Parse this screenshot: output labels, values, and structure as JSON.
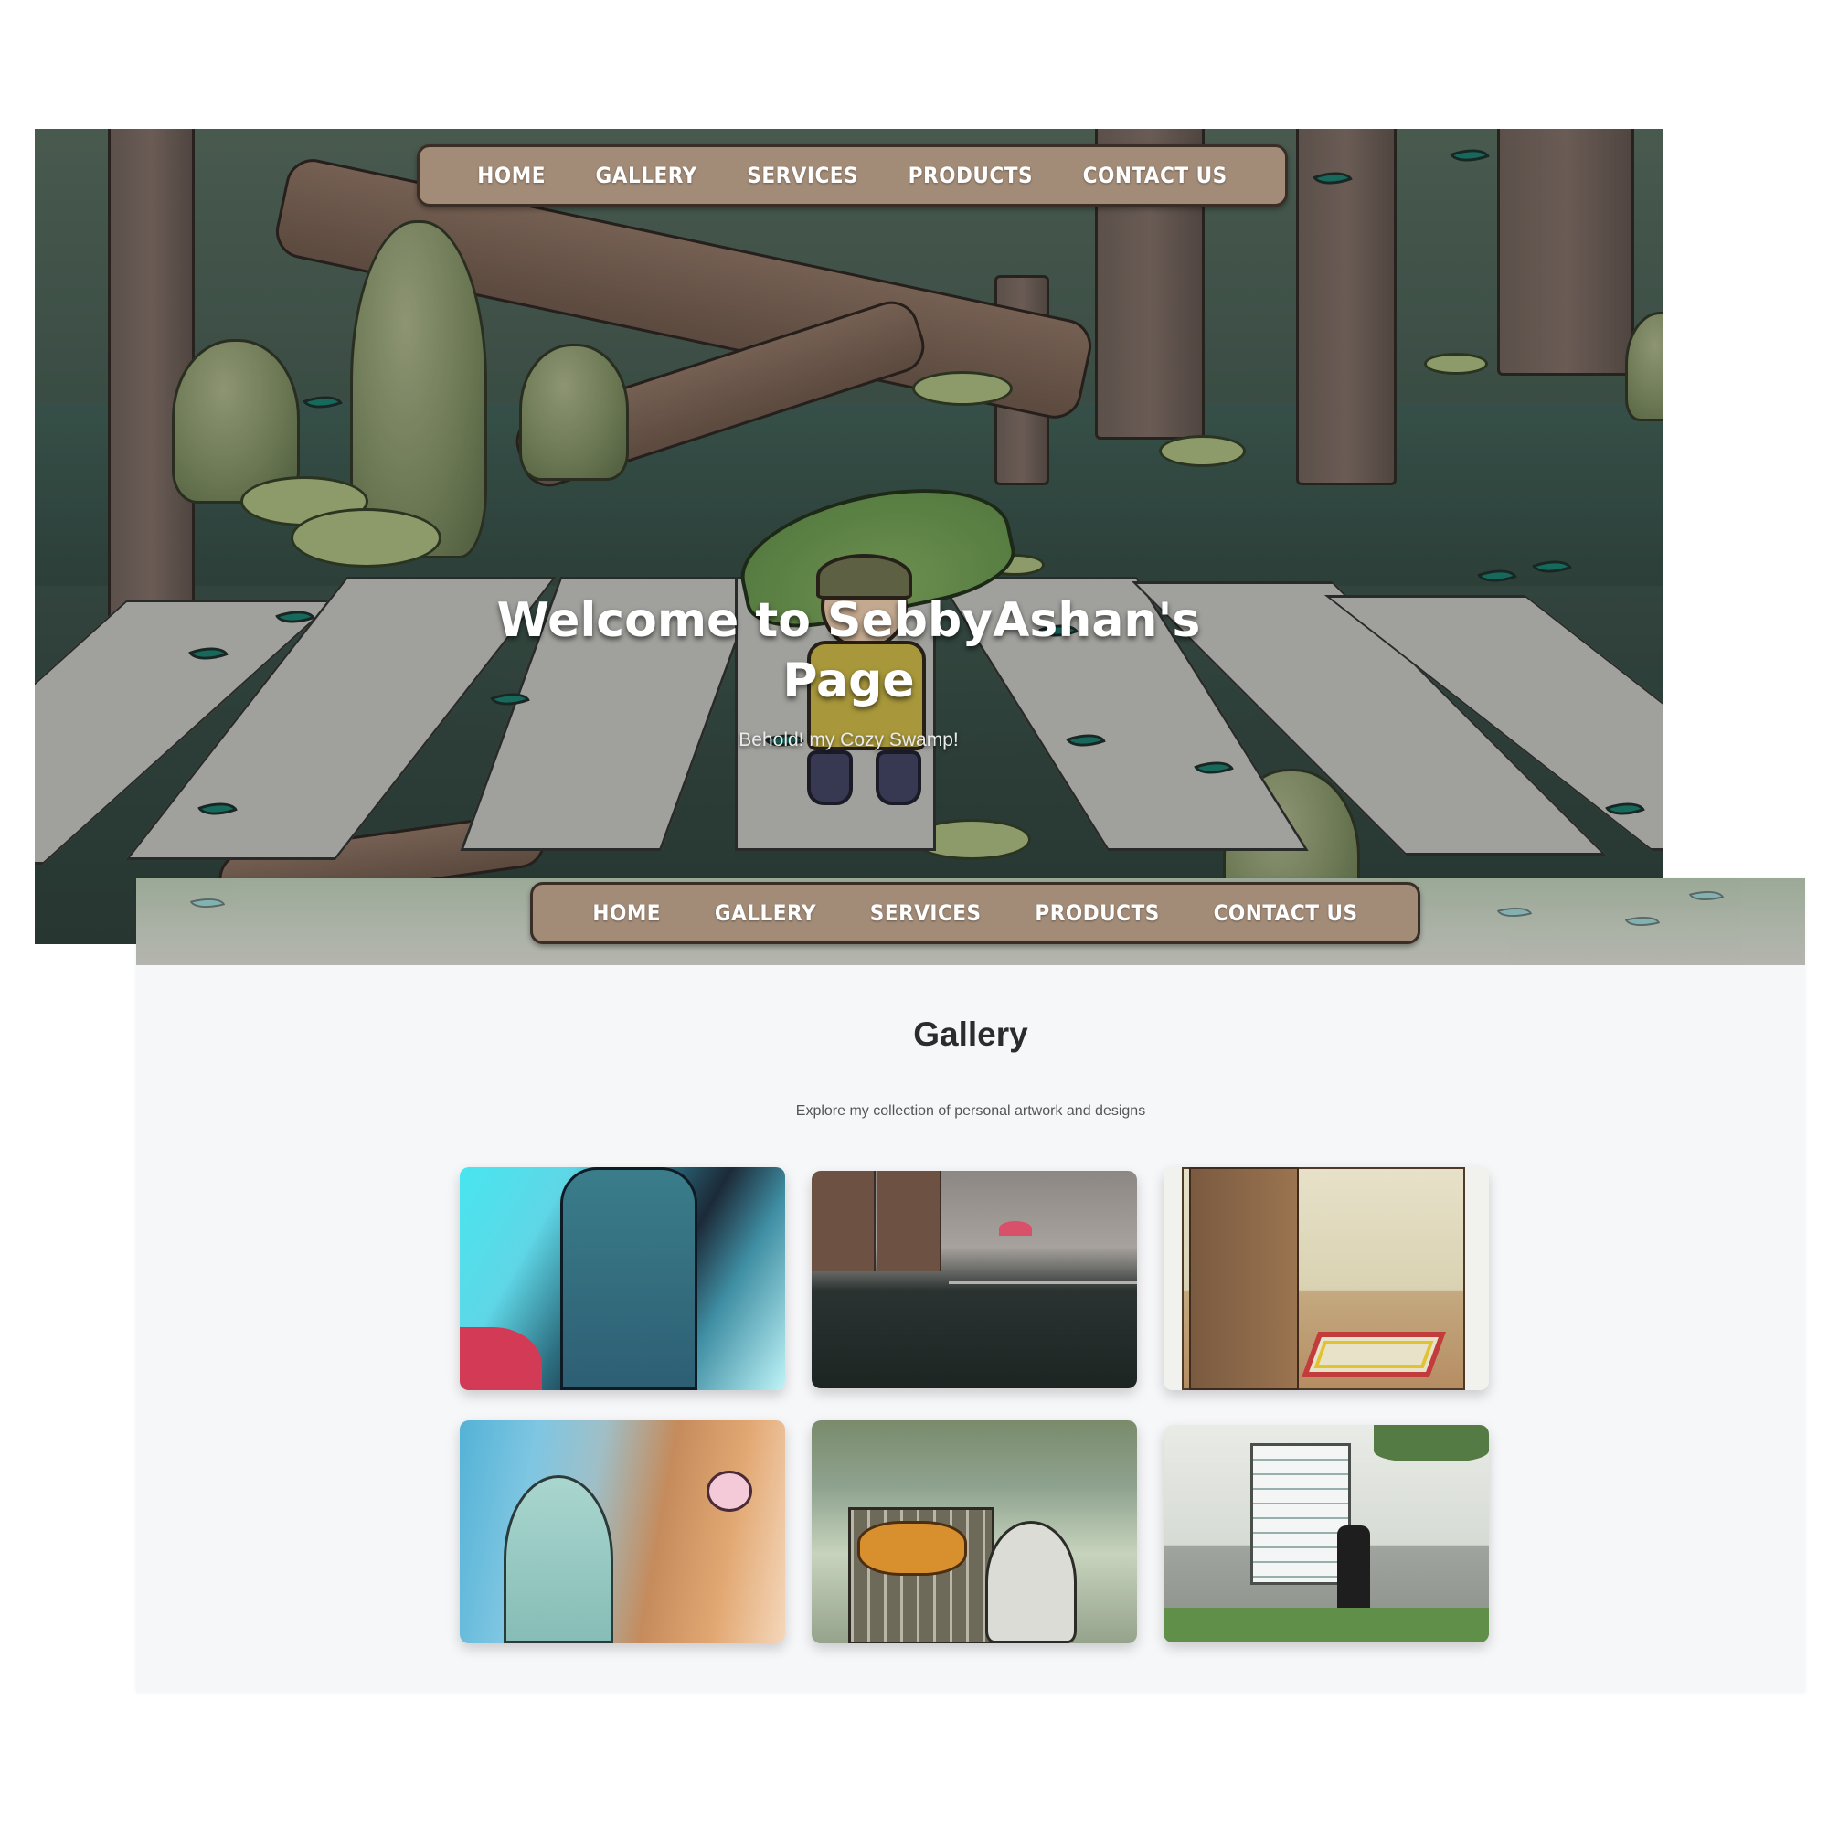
{
  "nav": {
    "items": [
      "HOME",
      "GALLERY",
      "SERVICES",
      "PRODUCTS",
      "CONTACT US"
    ]
  },
  "hero": {
    "title_line1": "Welcome to SebbyAshan's",
    "title_line2": "Page",
    "subtitle": "Behold! my Cozy Swamp!"
  },
  "gallery": {
    "title": "Gallery",
    "subtitle": "Explore my collection of personal artwork and designs",
    "items": [
      "artwork-1",
      "artwork-2",
      "artwork-3",
      "artwork-4",
      "artwork-5",
      "artwork-6"
    ]
  },
  "colors": {
    "nav_bg": "#a28b77",
    "nav_border": "#3a2d25",
    "page_bg": "#f6f7f9",
    "title_text": "#2c2c2c"
  }
}
